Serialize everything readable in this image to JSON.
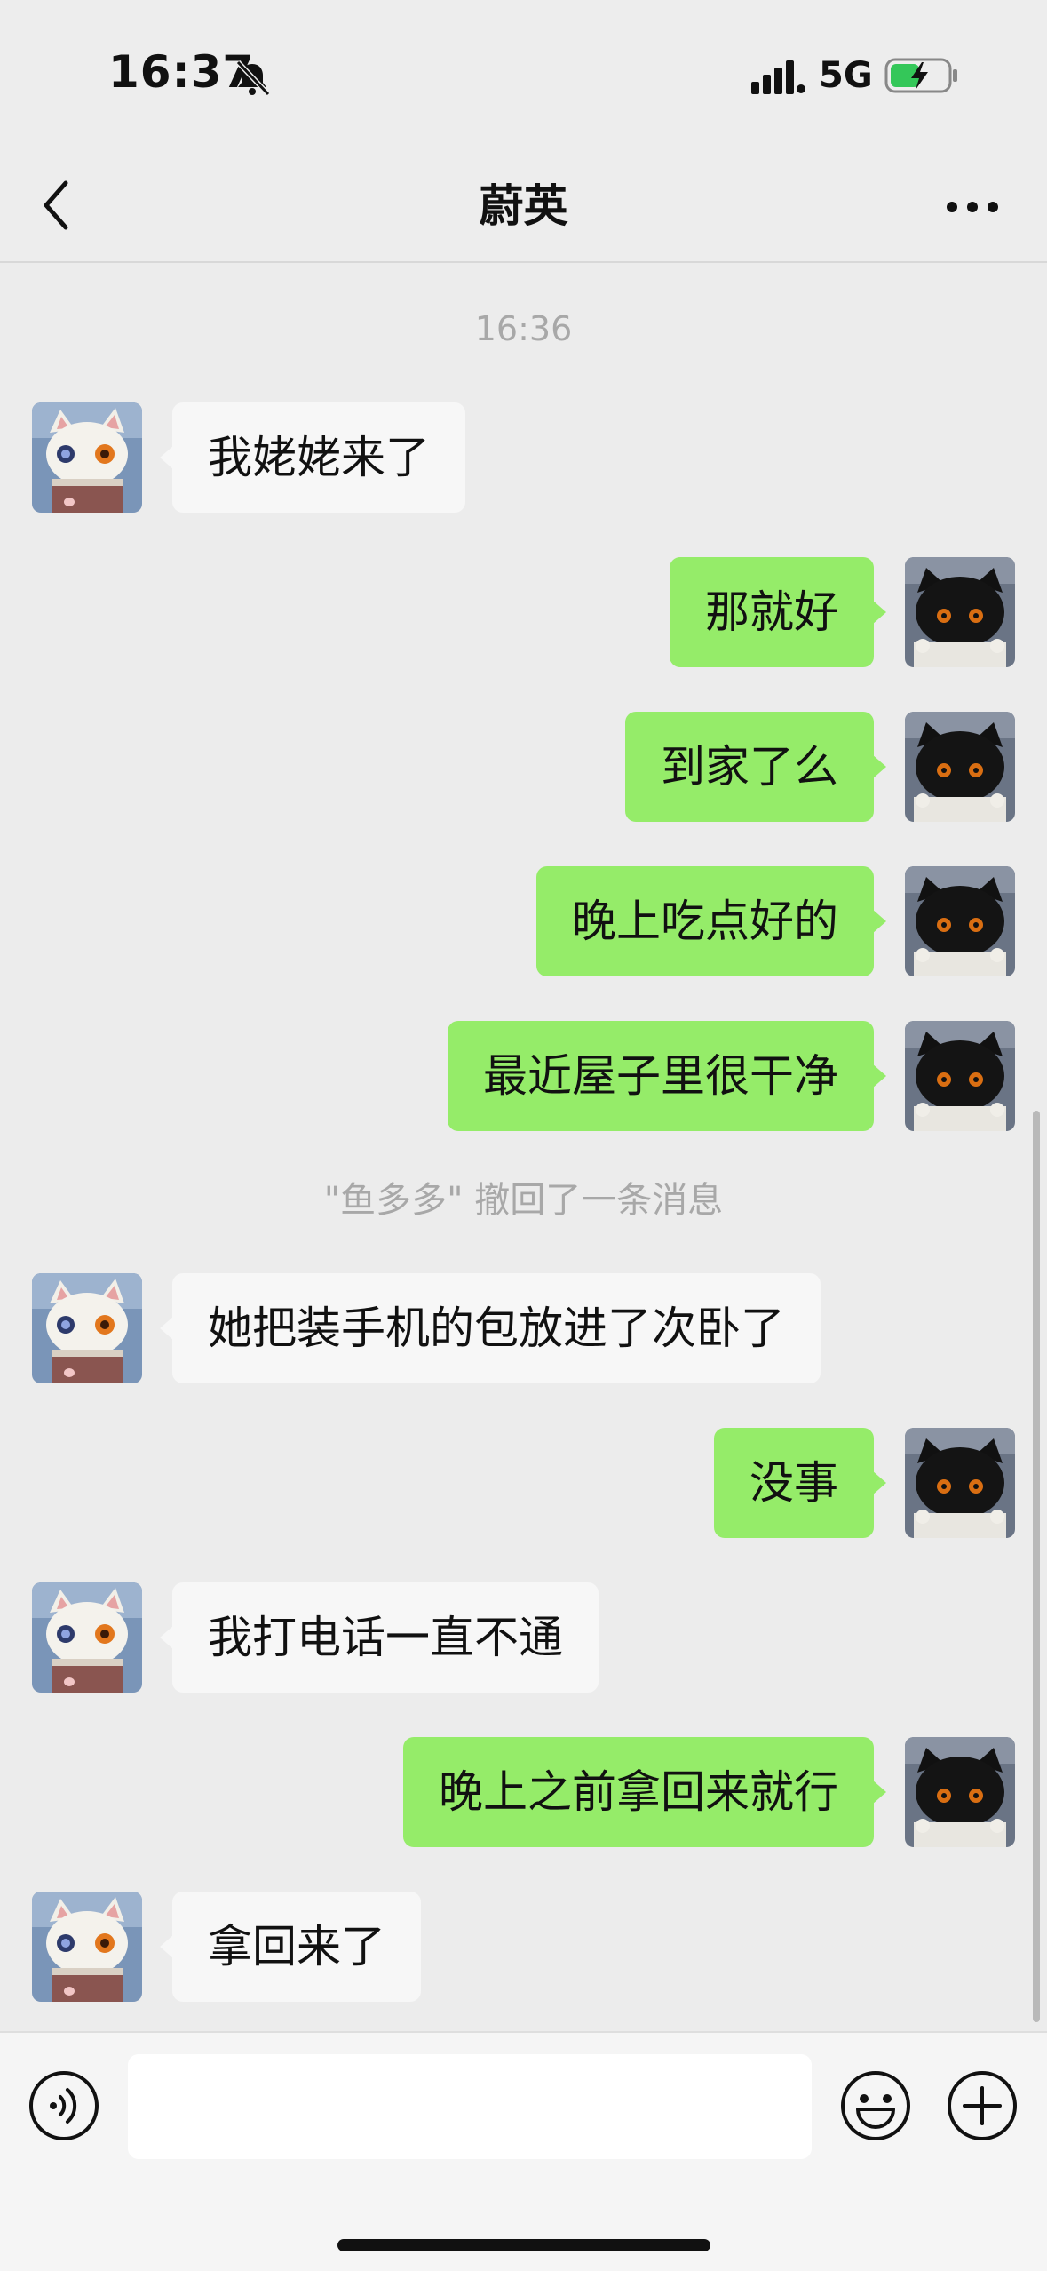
{
  "status_bar": {
    "time": "16:37",
    "network": "5G"
  },
  "header": {
    "title": "蔚英"
  },
  "chat": {
    "timestamp": "16:36",
    "recall_notice": "\"鱼多多\" 撤回了一条消息",
    "messages": [
      {
        "side": "left",
        "text": "我姥姥来了"
      },
      {
        "side": "right",
        "text": "那就好"
      },
      {
        "side": "right",
        "text": "到家了么"
      },
      {
        "side": "right",
        "text": "晚上吃点好的"
      },
      {
        "side": "right",
        "text": "最近屋子里很干净"
      },
      {
        "side": "left",
        "text": "她把装手机的包放进了次卧了"
      },
      {
        "side": "right",
        "text": "没事"
      },
      {
        "side": "left",
        "text": "我打电话一直不通"
      },
      {
        "side": "right",
        "text": "晚上之前拿回来就行"
      },
      {
        "side": "left",
        "text": "拿回来了"
      }
    ]
  },
  "input_bar": {
    "value": "",
    "placeholder": ""
  },
  "colors": {
    "sent_bubble": "#95ec69",
    "received_bubble": "#f7f7f7",
    "background": "#ececec"
  }
}
